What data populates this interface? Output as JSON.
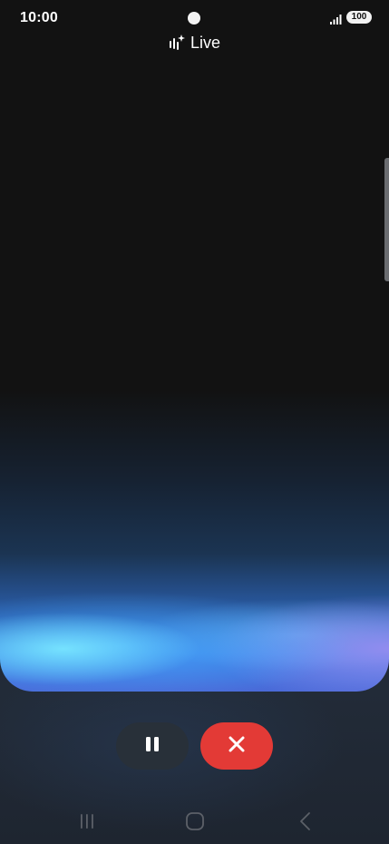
{
  "status_bar": {
    "time": "10:00",
    "battery_level": "100",
    "icons": [
      "camera-cutout",
      "signal-icon",
      "battery-icon"
    ]
  },
  "header": {
    "title": "Live",
    "icon": "sparkle-audio-icon"
  },
  "controls": {
    "pause_icon": "pause-icon",
    "stop_icon": "close-icon"
  },
  "nav_bar": {
    "items": [
      "recent-apps-icon",
      "home-icon",
      "back-icon"
    ]
  },
  "colors": {
    "background": "#121212",
    "stop_button": "#e33a36",
    "pause_button": "#283039",
    "glow_cyan": "#78e6ff",
    "glow_violet": "#968cf0"
  }
}
